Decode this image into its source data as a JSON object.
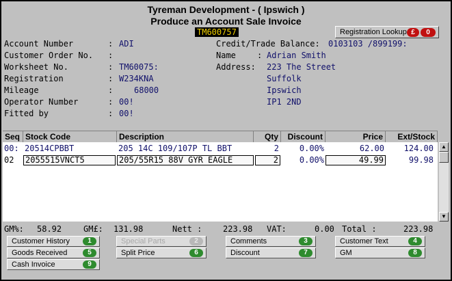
{
  "header": {
    "title": "Tyreman Development - ( Ipswich )",
    "subtitle": "Produce an Account Sale Invoice",
    "worksheet_badge": "TM600757"
  },
  "registration_lookup": {
    "label": "Registration Lookup",
    "currency": "£",
    "key": "0"
  },
  "details_left": [
    {
      "label": "Account Number",
      "sep": ":",
      "value": "ADI"
    },
    {
      "label": "Customer Order No.",
      "sep": ":",
      "value": ""
    },
    {
      "label": "Worksheet No.",
      "sep": ":",
      "value": "TM60075:"
    },
    {
      "label": "Registration",
      "sep": ":",
      "value": "W234KNA"
    },
    {
      "label": "Mileage",
      "sep": ":",
      "value": "68000"
    },
    {
      "label": "Operator Number",
      "sep": ":",
      "value": "00!"
    },
    {
      "label": "Fitted by",
      "sep": ":",
      "value": "00!"
    }
  ],
  "details_right": {
    "credit_label": "Credit/Trade Balance:",
    "credit_value": "0103103 /899199:",
    "name_label": "Name",
    "name_sep": ":",
    "name_value": "Adrian Smith",
    "address_label": "Address:",
    "address_lines": [
      "223 The Street",
      "Suffolk",
      "Ipswich",
      "IP1 2ND"
    ]
  },
  "table": {
    "headers": {
      "seq": "Seq",
      "stock_code": "Stock Code",
      "description": "Description",
      "qty": "Qty",
      "discount": "Discount",
      "price": "Price",
      "ext": "Ext/Stock"
    },
    "rows": [
      {
        "seq": "00:",
        "stock_code": "20514CPBBT",
        "description": "205 14C 109/107P  TL BBT",
        "qty": "2",
        "discount": "0.00%",
        "price": "62.00",
        "ext": "124.00"
      },
      {
        "seq": "02",
        "stock_code": "2055515VNCT5",
        "description": "205/55R15 88V GYR EAGLE",
        "qty": "2",
        "discount": "0.00%",
        "price": "49.99",
        "ext": "99.98"
      }
    ]
  },
  "totals": {
    "gm_pct_label": "GM%:",
    "gm_pct_value": "58.92",
    "gm_amt_label": "GM£:",
    "gm_amt_value": "131.98",
    "nett_label": "Nett :",
    "nett_value": "223.98",
    "vat_label": "VAT:",
    "vat_value": "0.00",
    "total_label": "Total :",
    "total_value": "223.98"
  },
  "function_buttons": [
    {
      "label": "Customer History",
      "key": "1",
      "enabled": true
    },
    {
      "label": "Special Parts",
      "key": "2",
      "enabled": false
    },
    {
      "label": "Comments",
      "key": "3",
      "enabled": true
    },
    {
      "label": "Customer Text",
      "key": "4",
      "enabled": true
    },
    {
      "label": "Goods Received",
      "key": "5",
      "enabled": true
    },
    {
      "label": "Split Price",
      "key": "6",
      "enabled": true
    },
    {
      "label": "Discount",
      "key": "7",
      "enabled": true
    },
    {
      "label": "GM",
      "key": "8",
      "enabled": true
    },
    {
      "label": "Cash Invoice",
      "key": "9",
      "enabled": true
    }
  ],
  "colors": {
    "key_green": "#2e8b2e",
    "key_red": "#c01010",
    "value_text": "#10106a",
    "badge_bg": "#000000",
    "badge_fg": "#f0d000"
  }
}
